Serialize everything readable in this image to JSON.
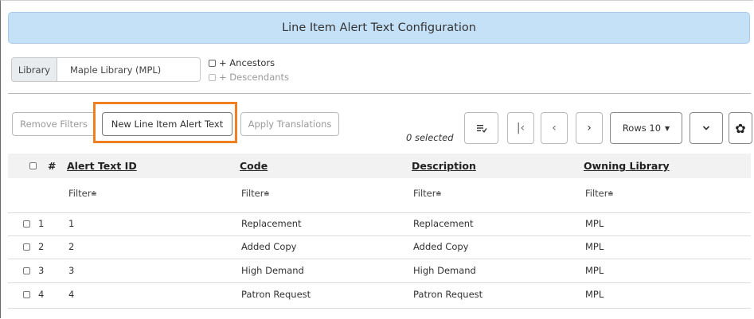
{
  "title": "Line Item Alert Text Configuration",
  "library": {
    "label": "Library",
    "value": "Maple Library (MPL)",
    "ancestors_label": "+ Ancestors",
    "descendants_label": "+ Descendants"
  },
  "toolbar": {
    "remove_filters": "Remove Filters",
    "new_item": "New Line Item Alert Text",
    "apply_translations": "Apply Translations",
    "selected": "0 selected",
    "rows": "Rows 10"
  },
  "table": {
    "columns": [
      "#",
      "Alert Text ID",
      "Code",
      "Description",
      "Owning Library"
    ],
    "filter_label": "Filter",
    "rows": [
      {
        "num": "1",
        "id": "1",
        "code": "Replacement",
        "description": "Replacement",
        "library": "MPL"
      },
      {
        "num": "2",
        "id": "2",
        "code": "Added Copy",
        "description": "Added Copy",
        "library": "MPL"
      },
      {
        "num": "3",
        "id": "3",
        "code": "High Demand",
        "description": "High Demand",
        "library": "MPL"
      },
      {
        "num": "4",
        "id": "4",
        "code": "Patron Request",
        "description": "Patron Request",
        "library": "MPL"
      }
    ]
  },
  "colors": {
    "title_bg": "#c5e1f8",
    "highlight": "#f07f22",
    "header_bg": "#f2f2f2"
  }
}
